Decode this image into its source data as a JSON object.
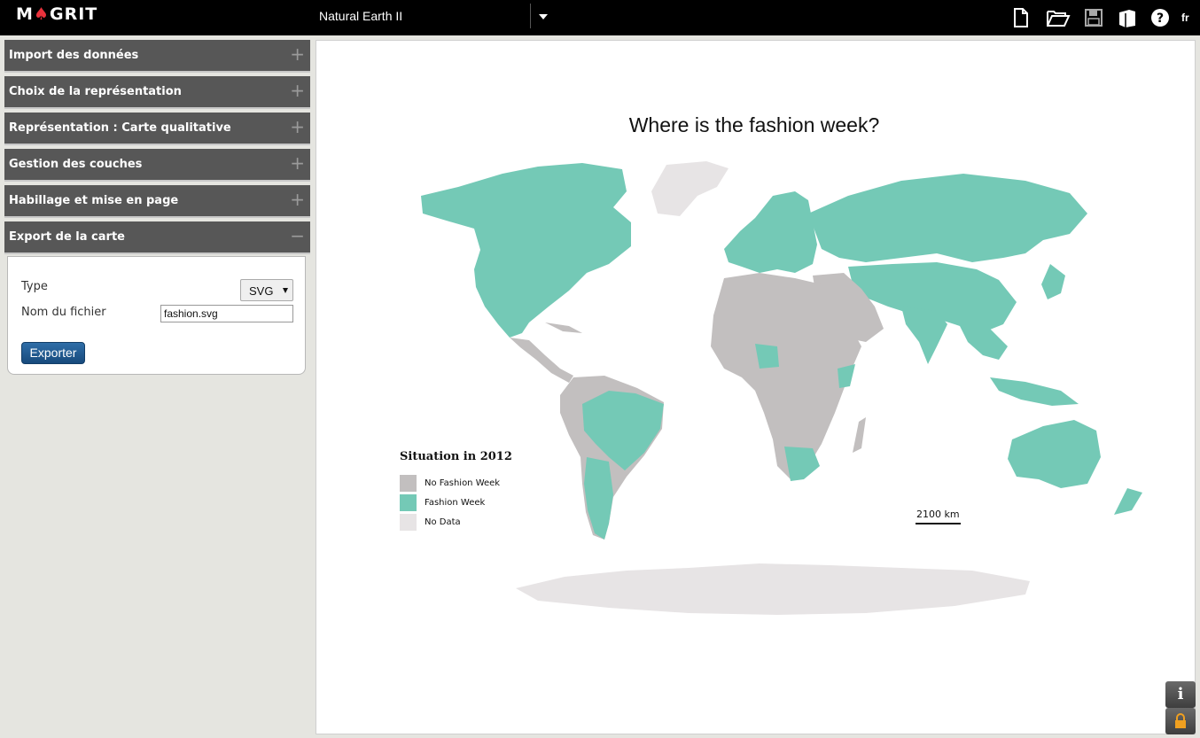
{
  "app": {
    "logo_text_1": "M",
    "logo_text_2": "GRIT",
    "projection": "Natural Earth II",
    "language": "fr",
    "toolbar_icons": [
      "new-file-icon",
      "open-folder-icon",
      "save-icon",
      "book-icon",
      "help-icon"
    ]
  },
  "sidebar": {
    "sections": [
      {
        "label": "Import des données",
        "state": "+"
      },
      {
        "label": "Choix de la représentation",
        "state": "+"
      },
      {
        "label": "Représentation : Carte qualitative",
        "state": "+"
      },
      {
        "label": "Gestion des couches",
        "state": "+"
      },
      {
        "label": "Habillage et mise en page",
        "state": "+"
      },
      {
        "label": "Export de la carte",
        "state": "−"
      }
    ],
    "export": {
      "type_label": "Type",
      "type_value": "SVG",
      "filename_label": "Nom du fichier",
      "filename_value": "fashion.svg",
      "export_button": "Exporter"
    }
  },
  "map": {
    "title": "Where is the fashion week?",
    "legend_title": "Situation in 2012",
    "legend": [
      {
        "label": "No Fashion Week",
        "color": "#c2bfbf"
      },
      {
        "label": "Fashion Week",
        "color": "#74c9b6"
      },
      {
        "label": "No Data",
        "color": "#e7e4e5"
      }
    ],
    "scale_label": "2100 km",
    "side_buttons": [
      "info-icon",
      "lock-icon"
    ]
  }
}
